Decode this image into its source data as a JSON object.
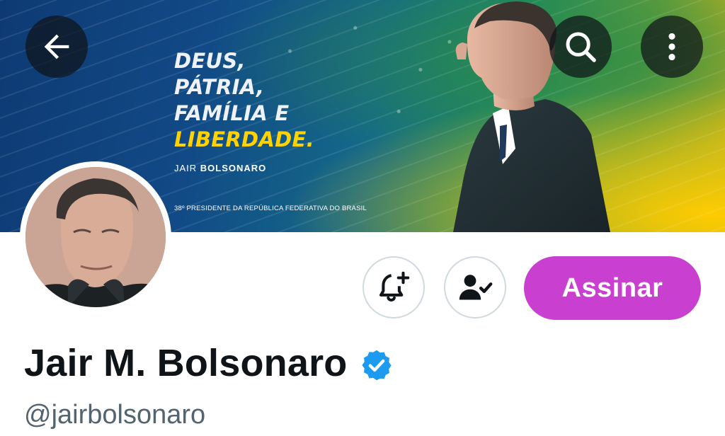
{
  "banner": {
    "slogan_line1": "DEUS,",
    "slogan_line2": "PÁTRIA,",
    "slogan_line3": "FAMÍLIA E",
    "slogan_line4": "LIBERDADE.",
    "signature_first": "JAIR",
    "signature_last": "BOLSONARO",
    "subline": "38º PRESIDENTE DA REPÚBLICA FEDERATIVA DO BRASIL"
  },
  "topbar": {
    "back_icon": "arrow-left-icon",
    "search_icon": "search-icon",
    "more_icon": "more-vertical-icon"
  },
  "actions": {
    "bell_icon": "bell-plus-icon",
    "following_icon": "person-check-icon",
    "subscribe_label": "Assinar",
    "subscribe_color": "#c93fcf"
  },
  "profile": {
    "display_name": "Jair M. Bolsonaro",
    "verified_icon": "verified-badge-icon",
    "handle": "@jairbolsonaro",
    "verified_color": "#1d9bf0"
  }
}
